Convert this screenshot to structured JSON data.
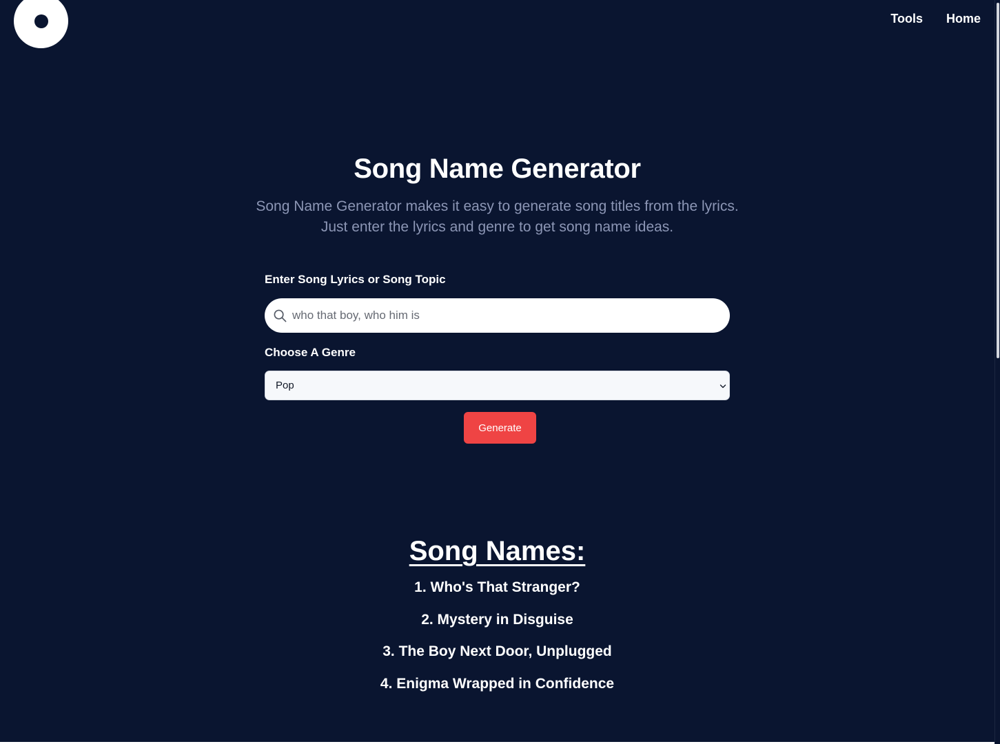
{
  "nav": {
    "tools": "Tools",
    "home": "Home"
  },
  "hero": {
    "title": "Song Name Generator",
    "subtitle": "Song Name Generator makes it easy to generate song titles from the lyrics. Just enter the lyrics and genre to get song name ideas."
  },
  "form": {
    "lyrics_label": "Enter Song Lyrics or Song Topic",
    "lyrics_placeholder": "who that boy, who him is",
    "genre_label": "Choose A Genre",
    "genre_selected": "Pop",
    "generate_label": "Generate"
  },
  "results": {
    "heading": "Song Names:",
    "items": [
      "1. Who's That Stranger?",
      "2. Mystery in Disguise",
      "3. The Boy Next Door, Unplugged",
      "4. Enigma Wrapped in Confidence"
    ]
  },
  "colors": {
    "background": "#0a1530",
    "accent": "#ef4444",
    "subtitle": "#8c96b5"
  },
  "icons": {
    "logo": "disc-logo",
    "search": "search-icon",
    "select": "chevron-down-icon"
  }
}
